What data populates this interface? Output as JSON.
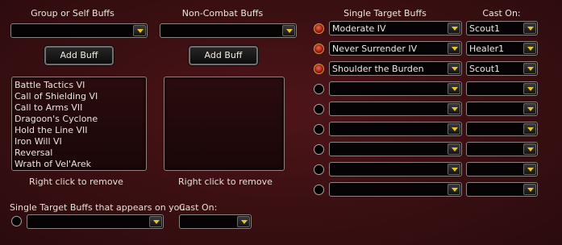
{
  "group": {
    "header": "Group or Self Buffs",
    "select_value": "",
    "add_button": "Add Buff",
    "list": [
      "Battle Tactics VI",
      "Call of Shielding VI",
      "Call to Arms VII",
      "Dragoon's Cyclone",
      "Hold the Line VII",
      "Iron Will VI",
      "Reversal",
      "Wrath of Vel'Arek"
    ],
    "remove_hint": "Right click to remove"
  },
  "noncombat": {
    "header": "Non-Combat Buffs",
    "select_value": "",
    "add_button": "Add Buff",
    "list": [],
    "remove_hint": "Right click to remove"
  },
  "single_target": {
    "header": "Single Target Buffs",
    "cast_header": "Cast On:",
    "rows": [
      {
        "buff": "Moderate IV",
        "cast": "Scout1",
        "selected": true
      },
      {
        "buff": "Never Surrender IV",
        "cast": "Healer1",
        "selected": true
      },
      {
        "buff": "Shoulder the Burden",
        "cast": "Scout1",
        "selected": true
      },
      {
        "buff": "",
        "cast": "",
        "selected": false
      },
      {
        "buff": "",
        "cast": "",
        "selected": false
      },
      {
        "buff": "",
        "cast": "",
        "selected": false
      },
      {
        "buff": "",
        "cast": "",
        "selected": false
      },
      {
        "buff": "",
        "cast": "",
        "selected": false
      },
      {
        "buff": "",
        "cast": "",
        "selected": false
      }
    ]
  },
  "on_you": {
    "label": "Single Target Buffs that appears on you",
    "select_value": "",
    "cast_label": "Cast On:",
    "cast_value": ""
  },
  "colors": {
    "accent": "#e8c22a",
    "background": "#3d1013"
  }
}
